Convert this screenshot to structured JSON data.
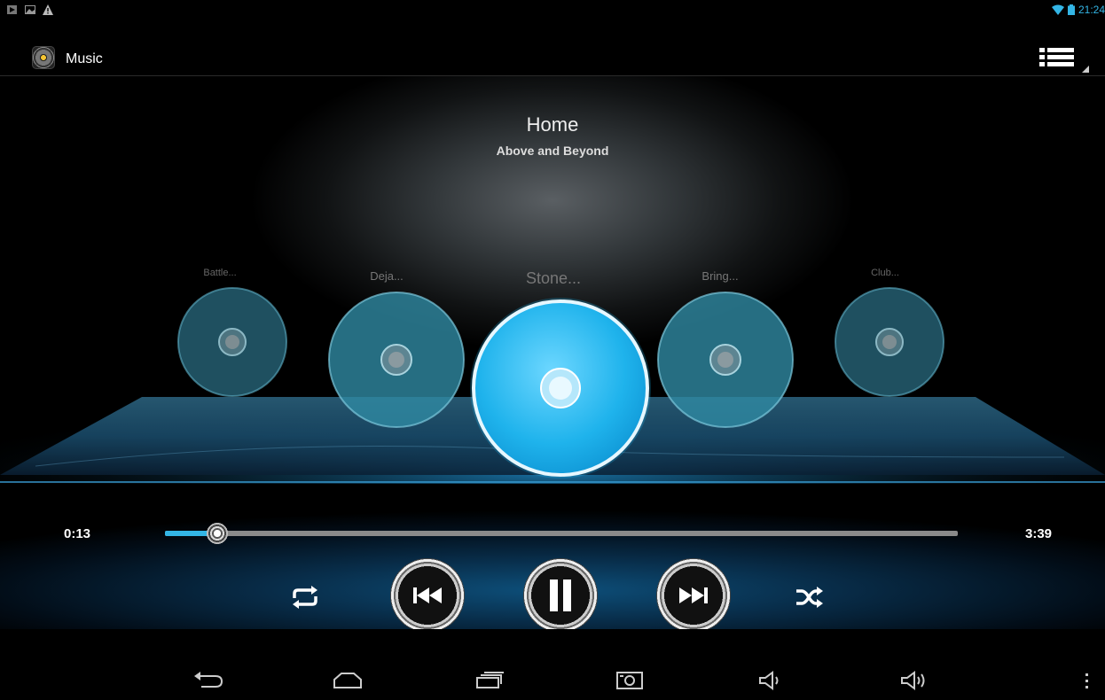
{
  "status_bar": {
    "time": "21:24",
    "left_icons": [
      "play-notification-icon",
      "image-notification-icon",
      "warning-icon"
    ],
    "right_icons": [
      "wifi-icon",
      "battery-icon"
    ]
  },
  "action_bar": {
    "app_icon": "music-app-icon",
    "title": "Music",
    "menu_icon": "list-icon"
  },
  "now_playing": {
    "title": "Home",
    "artist": "Above and Beyond"
  },
  "carousel": {
    "discs": [
      {
        "label": "Battle..."
      },
      {
        "label": "Deja..."
      },
      {
        "label": "Stone..."
      },
      {
        "label": "Bring..."
      },
      {
        "label": "Club..."
      }
    ],
    "selected_index": 2
  },
  "playback": {
    "elapsed": "0:13",
    "duration": "3:39",
    "progress": 0.066
  },
  "controls": {
    "repeat_icon": "repeat-icon",
    "previous_icon": "previous-icon",
    "pause_icon": "pause-icon",
    "next_icon": "next-icon",
    "shuffle_icon": "shuffle-icon"
  },
  "nav_bar": {
    "icons": [
      "back-icon",
      "home-icon",
      "recent-apps-icon",
      "screenshot-icon",
      "volume-down-icon",
      "volume-up-icon",
      "overflow-menu-icon"
    ]
  },
  "colors": {
    "accent": "#33b5e5",
    "disc_selected": "#1fb3ec",
    "disc_dim": "#2f7f98"
  }
}
